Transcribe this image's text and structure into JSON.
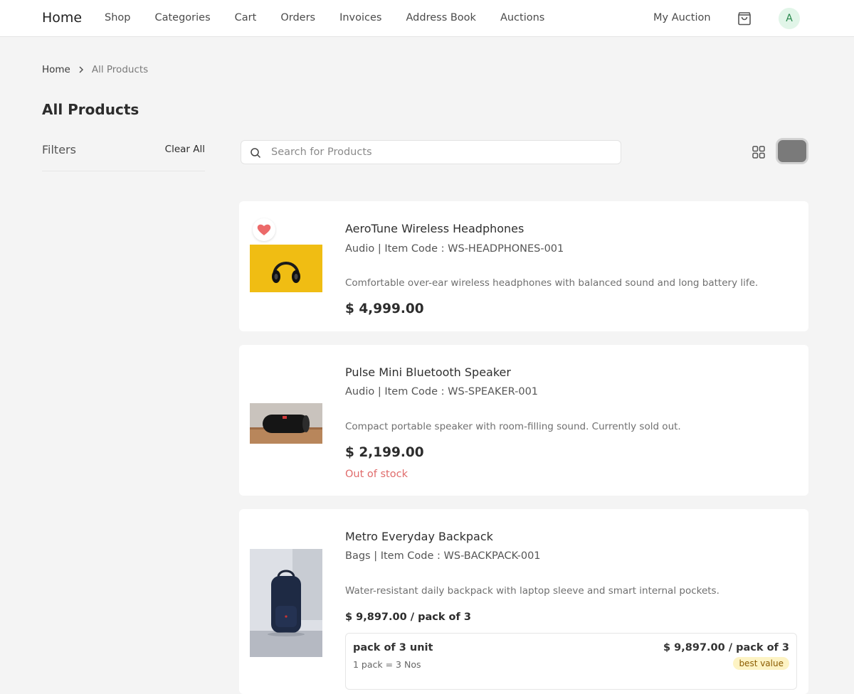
{
  "nav": {
    "brand": "Home",
    "links": [
      "Shop",
      "Categories",
      "Cart",
      "Orders",
      "Invoices",
      "Address Book",
      "Auctions"
    ],
    "my_auction": "My Auction",
    "avatar_initial": "A"
  },
  "breadcrumb": {
    "home": "Home",
    "current": "All Products"
  },
  "page_title": "All Products",
  "filters": {
    "label": "Filters",
    "clear_all": "Clear All"
  },
  "search": {
    "placeholder": "Search for Products",
    "value": ""
  },
  "products": [
    {
      "title": "AeroTune Wireless Headphones",
      "meta": "Audio | Item Code : WS-HEADPHONES-001",
      "description": "Comfortable over-ear wireless headphones with balanced sound and long battery life.",
      "price": "$ 4,999.00",
      "wishlisted": true,
      "image_icon": "headphones-image"
    },
    {
      "title": "Pulse Mini Bluetooth Speaker",
      "meta": "Audio | Item Code : WS-SPEAKER-001",
      "description": "Compact portable speaker with room-filling sound. Currently sold out.",
      "price": "$ 2,199.00",
      "stock_status": "Out of stock",
      "image_icon": "speaker-image"
    },
    {
      "title": "Metro Everyday Backpack",
      "meta": "Bags | Item Code : WS-BACKPACK-001",
      "description": "Water-resistant daily backpack with laptop sleeve and smart internal pockets.",
      "price": "$ 9,897.00 / pack of 3",
      "image_icon": "backpack-image",
      "uom": {
        "name": "pack of 3 unit",
        "conversion": "1 pack = 3 Nos",
        "price": "$ 9,897.00 / pack of 3",
        "badge": "best value"
      }
    }
  ],
  "colors": {
    "background": "#f4f4f4",
    "card": "#ffffff",
    "out_of_stock": "#e06b6b",
    "wishlist_heart": "#ec6a6a",
    "avatar_bg": "#e1f5e8",
    "badge_bg": "#fdf3c4"
  }
}
